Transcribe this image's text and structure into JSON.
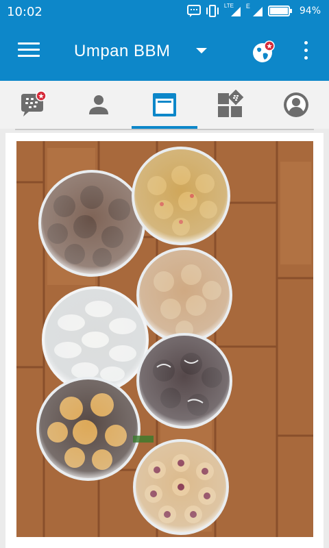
{
  "status_bar": {
    "time": "10:02",
    "network_label": "LTE",
    "network_label_2": "E",
    "battery_percent": "94%"
  },
  "app_bar": {
    "title": "Umpan BBM"
  },
  "tabs": [
    {
      "name": "chats",
      "icon": "chat-bubble-icon",
      "active": false,
      "badge": true
    },
    {
      "name": "contacts",
      "icon": "person-icon",
      "active": false,
      "badge": false
    },
    {
      "name": "feeds",
      "icon": "feed-window-icon",
      "active": true,
      "badge": false
    },
    {
      "name": "discover",
      "icon": "shop-blocks-icon",
      "active": false,
      "badge": false
    },
    {
      "name": "me",
      "icon": "profile-circle-icon",
      "active": false,
      "badge": false
    }
  ],
  "colors": {
    "primary": "#0d87c9",
    "badge": "#d62b3a",
    "tab_icon": "#6d6d6d"
  },
  "feed": {
    "photo_subject": "cookie-jars-photo"
  }
}
